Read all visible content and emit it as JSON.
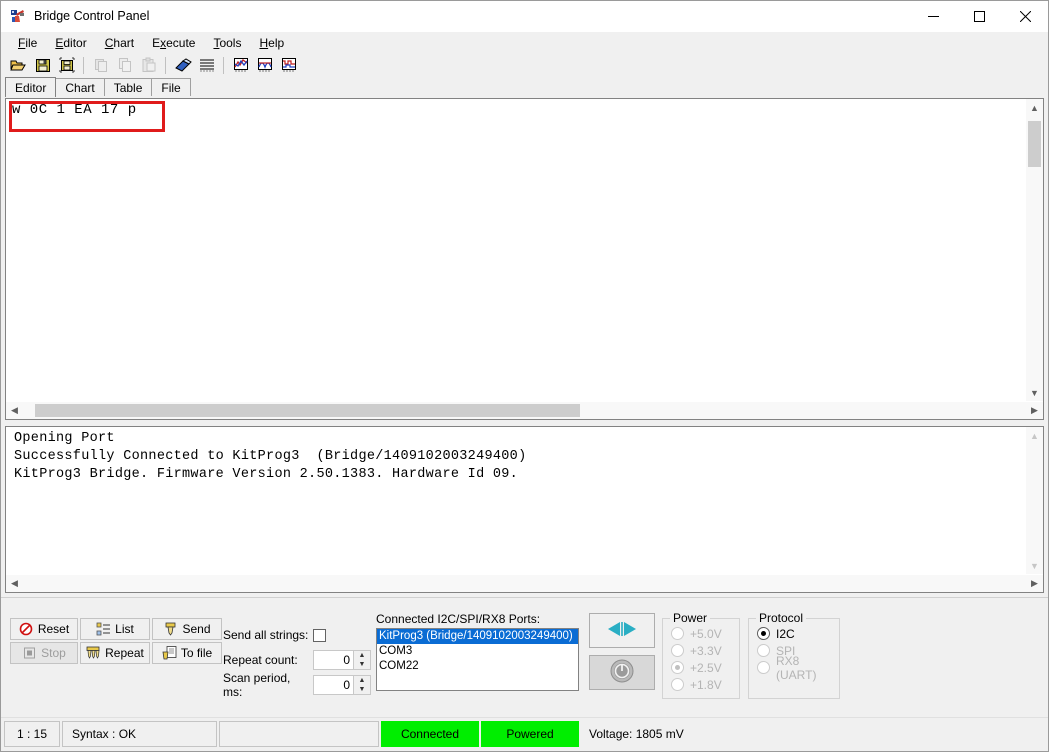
{
  "window": {
    "title": "Bridge Control Panel",
    "icon": "bridge-app-icon",
    "minimize_label": "—",
    "maximize_label": "□",
    "close_label": "✕"
  },
  "menubar": {
    "items": [
      {
        "label": "File",
        "mnemonic": "F"
      },
      {
        "label": "Editor",
        "mnemonic": "E"
      },
      {
        "label": "Chart",
        "mnemonic": "C"
      },
      {
        "label": "Execute",
        "mnemonic": "x"
      },
      {
        "label": "Tools",
        "mnemonic": "T"
      },
      {
        "label": "Help",
        "mnemonic": "H"
      }
    ]
  },
  "toolbar": {
    "buttons": [
      {
        "name": "open-file-icon",
        "enabled": true
      },
      {
        "name": "save-file-icon",
        "enabled": true
      },
      {
        "name": "save-as-file-icon",
        "enabled": true
      },
      {
        "name": "cut-icon",
        "enabled": false
      },
      {
        "name": "copy-icon",
        "enabled": false
      },
      {
        "name": "paste-icon",
        "enabled": false
      },
      {
        "name": "eraser-clear-icon",
        "enabled": true
      },
      {
        "name": "list-lines-icon",
        "enabled": true
      },
      {
        "name": "chart-line-icon",
        "enabled": true
      },
      {
        "name": "chart-scope-icon",
        "enabled": true
      },
      {
        "name": "chart-digital-icon",
        "enabled": true
      }
    ]
  },
  "tabs": {
    "items": [
      {
        "label": "Editor",
        "active": true
      },
      {
        "label": "Chart",
        "active": false
      },
      {
        "label": "Table",
        "active": false
      },
      {
        "label": "File",
        "active": false
      }
    ]
  },
  "editor": {
    "line1": "w 0C 1 EA 17 p",
    "highlight_color": "#e01b1b"
  },
  "log": {
    "line1": "Opening Port",
    "line2": "Successfully Connected to KitProg3  (Bridge/1409102003249400)",
    "line3": "KitProg3 Bridge. Firmware Version 2.50.1383. Hardware Id 09."
  },
  "controls": {
    "buttons": [
      {
        "label": "Reset",
        "icon": "reset-icon",
        "enabled": true
      },
      {
        "label": "List",
        "icon": "list-icon",
        "enabled": true
      },
      {
        "label": "Send",
        "icon": "send-icon",
        "enabled": true
      },
      {
        "label": "Stop",
        "icon": "stop-icon",
        "enabled": false
      },
      {
        "label": "Repeat",
        "icon": "repeat-icon",
        "enabled": true
      },
      {
        "label": "To file",
        "icon": "to-file-icon",
        "enabled": true
      }
    ],
    "send_all_strings_label": "Send all strings:",
    "send_all_strings_checked": false,
    "repeat_count_label": "Repeat count:",
    "repeat_count_value": "0",
    "scan_period_label": "Scan period, ms:",
    "scan_period_value": "0"
  },
  "ports": {
    "label": "Connected I2C/SPI/RX8 Ports:",
    "items": [
      {
        "label": "KitProg3 (Bridge/1409102003249400)",
        "selected": true
      },
      {
        "label": "COM3",
        "selected": false
      },
      {
        "label": "COM22",
        "selected": false
      }
    ]
  },
  "actions": {
    "connect_icon": "connect-transfer-icon",
    "power_icon": "power-toggle-icon"
  },
  "power": {
    "title": "Power",
    "options": [
      {
        "label": "+5.0V",
        "selected": false,
        "enabled": false
      },
      {
        "label": "+3.3V",
        "selected": false,
        "enabled": false
      },
      {
        "label": "+2.5V",
        "selected": true,
        "enabled": false
      },
      {
        "label": "+1.8V",
        "selected": false,
        "enabled": false
      }
    ]
  },
  "protocol": {
    "title": "Protocol",
    "options": [
      {
        "label": "I2C",
        "selected": true,
        "enabled": true
      },
      {
        "label": "SPI",
        "selected": false,
        "enabled": false
      },
      {
        "label": "RX8 (UART)",
        "selected": false,
        "enabled": false
      }
    ]
  },
  "statusbar": {
    "position": "1 : 15",
    "syntax": "Syntax : OK",
    "spare": "",
    "connected": "Connected",
    "powered": "Powered",
    "voltage": "Voltage: 1805 mV",
    "green": "#00ee00"
  }
}
